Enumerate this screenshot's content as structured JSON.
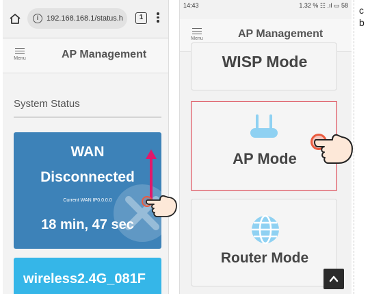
{
  "left_phone": {
    "browser": {
      "url": "192.168.168.1/status.h",
      "tab_count": "1"
    },
    "header": {
      "menu_label": "Menu",
      "title": "AP Management"
    },
    "section_title": "System Status",
    "wan_card": {
      "title": "WAN",
      "state": "Disconnected",
      "ip_line": "Current WAN IP0.0.0.0",
      "uptime": "18 min, 47 sec"
    },
    "wifi_card": {
      "ssid": "wireless2.4G_081F"
    }
  },
  "right_phone": {
    "status_bar": {
      "time": "14:43",
      "indicators": "1.32 % ☷ .ıl ▭ 58"
    },
    "header": {
      "menu_label": "Menu",
      "title": "AP Management"
    },
    "modes": [
      {
        "label": "WISP Mode"
      },
      {
        "label": "AP Mode"
      },
      {
        "label": "Router Mode"
      }
    ],
    "scroll_top": "^"
  },
  "cut_text": "c\nb",
  "colors": {
    "wan_card": "#3d82b8",
    "wifi_card": "#35b6e8",
    "selected_border": "#d9303e",
    "swipe_arrow": "#e0196b",
    "touch_ring": "#ea5b3f",
    "icon_light_blue": "#8fd1f2"
  }
}
